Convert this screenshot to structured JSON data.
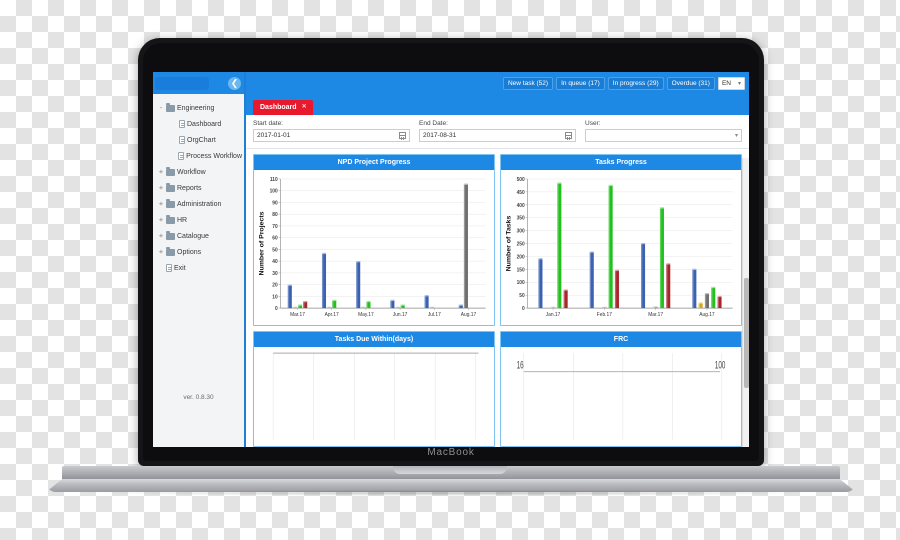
{
  "device": {
    "brand_label": "MacBook"
  },
  "sidebar": {
    "collapse_icon": "chevron-left-icon",
    "version": "ver. 0.8.30",
    "items": [
      {
        "label": "Engineering",
        "level": 1,
        "icon": "folder-icon",
        "expander": "-"
      },
      {
        "label": "Dashboard",
        "level": 2,
        "icon": "file-icon",
        "expander": ""
      },
      {
        "label": "OrgChart",
        "level": 2,
        "icon": "file-icon",
        "expander": ""
      },
      {
        "label": "Process Workflow",
        "level": 2,
        "icon": "file-icon",
        "expander": ""
      },
      {
        "label": "Workflow",
        "level": 1,
        "icon": "folder-icon",
        "expander": "+"
      },
      {
        "label": "Reports",
        "level": 1,
        "icon": "folder-icon",
        "expander": "+"
      },
      {
        "label": "Administration",
        "level": 1,
        "icon": "folder-icon",
        "expander": "+"
      },
      {
        "label": "HR",
        "level": 1,
        "icon": "folder-icon",
        "expander": "+"
      },
      {
        "label": "Catalogue",
        "level": 1,
        "icon": "folder-icon",
        "expander": "+"
      },
      {
        "label": "Options",
        "level": 1,
        "icon": "folder-icon",
        "expander": "+"
      },
      {
        "label": "Exit",
        "level": 1,
        "icon": "file-icon",
        "expander": ""
      }
    ]
  },
  "topbar": {
    "buttons": [
      {
        "label": "New task (52)"
      },
      {
        "label": "In queue (17)"
      },
      {
        "label": "In progress (29)"
      },
      {
        "label": "Overdue (31)"
      }
    ],
    "language": {
      "value": "EN",
      "chevron": "▾",
      "icon": "chevron-down-icon"
    }
  },
  "tabs": [
    {
      "label": "Dashboard",
      "close_icon": "close-icon",
      "close_glyph": "✕",
      "active": true
    }
  ],
  "filters": {
    "start_date": {
      "label": "Start date:",
      "value": "2017-01-01",
      "icon": "calendar-icon"
    },
    "end_date": {
      "label": "End Date:",
      "value": "2017-08-31",
      "icon": "calendar-icon"
    },
    "user": {
      "label": "User:",
      "value": "",
      "placeholder": "",
      "chevron": "▾",
      "icon": "chevron-down-icon"
    }
  },
  "panels": [
    {
      "title": "NPD Project Progress"
    },
    {
      "title": "Tasks Progress"
    },
    {
      "title": "Tasks Due Within(days)"
    },
    {
      "title": "FRC"
    }
  ],
  "colors": {
    "accent_blue": "#1e88e5",
    "tab_red": "#e8192c",
    "series_blue": "#3b62b0",
    "series_gray": "#6e6e6e",
    "series_green": "#22c11e",
    "series_red": "#a8262b",
    "series_yellow": "#d8a41a",
    "panel_border": "#7ec4f0"
  },
  "chart_data": [
    {
      "id": "npd-project-progress",
      "type": "bar",
      "title": "NPD Project Progress",
      "xlabel": "",
      "ylabel": "Number of Projects",
      "ylim": [
        0,
        110
      ],
      "ytick_step": 10,
      "yticks": [
        0,
        10,
        20,
        30,
        40,
        50,
        60,
        70,
        80,
        90,
        100,
        110
      ],
      "grid": true,
      "legend": "none",
      "categories": [
        "Mar.17",
        "Apr.17",
        "May.17",
        "Jun.17",
        "Jul.17",
        "Aug.17"
      ],
      "series": [
        {
          "name": "Blue",
          "color": "#3b62b0",
          "values": [
            20,
            47,
            40,
            7,
            11,
            3
          ]
        },
        {
          "name": "Gray",
          "color": "#6e6e6e",
          "values": [
            1,
            1,
            1,
            1,
            1,
            106
          ]
        },
        {
          "name": "Green",
          "color": "#22c11e",
          "values": [
            3,
            7,
            6,
            3,
            0,
            0
          ]
        },
        {
          "name": "Red",
          "color": "#a8262b",
          "values": [
            6,
            0,
            0,
            0,
            0,
            0
          ]
        }
      ]
    },
    {
      "id": "tasks-progress",
      "type": "bar",
      "title": "Tasks Progress",
      "xlabel": "",
      "ylabel": "Number of Tasks",
      "ylim": [
        0,
        500
      ],
      "ytick_step": 50,
      "yticks": [
        0,
        50,
        100,
        150,
        200,
        250,
        300,
        350,
        400,
        450,
        500
      ],
      "grid": true,
      "legend": "none",
      "categories": [
        "Jan.17",
        "Feb.17",
        "Mar.17",
        "Aug.17"
      ],
      "series": [
        {
          "name": "Blue",
          "color": "#3b62b0",
          "values": [
            193,
            219,
            252,
            152
          ]
        },
        {
          "name": "Yellow",
          "color": "#d8a41a",
          "values": [
            0,
            0,
            0,
            22
          ]
        },
        {
          "name": "Gray",
          "color": "#6e6e6e",
          "values": [
            4,
            4,
            6,
            58
          ]
        },
        {
          "name": "Green",
          "color": "#22c11e",
          "values": [
            486,
            477,
            390,
            82
          ]
        },
        {
          "name": "Red",
          "color": "#a8262b",
          "values": [
            72,
            148,
            173,
            47
          ]
        }
      ]
    },
    {
      "id": "tasks-due-within-days",
      "type": "bar",
      "title": "Tasks Due Within(days)",
      "xlabel": "",
      "ylabel": "",
      "grid": true,
      "legend": "none",
      "categories": [],
      "values": [],
      "note": "panel clipped at bottom of viewport"
    },
    {
      "id": "frc",
      "type": "bar",
      "title": "FRC",
      "xlabel": "",
      "ylabel": "",
      "grid": true,
      "legend": "none",
      "axis_left_label": "16",
      "axis_right_label": "100",
      "categories": [],
      "values": [],
      "note": "panel clipped at bottom of viewport"
    }
  ]
}
